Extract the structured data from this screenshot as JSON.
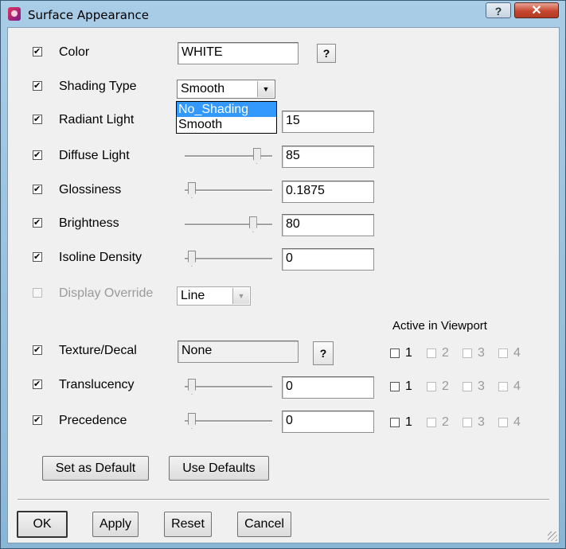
{
  "window": {
    "title": "Surface Appearance",
    "help_label": "?",
    "close_label": "✕"
  },
  "rows": [
    {
      "label": "Color",
      "value": "WHITE",
      "help": "?"
    },
    {
      "label": "Shading Type",
      "select": "Smooth",
      "options": [
        "No_Shading",
        "Smooth"
      ],
      "highlighted": "No_Shading"
    },
    {
      "label": "Radiant Light",
      "value": "15"
    },
    {
      "label": "Diffuse Light",
      "value": "85"
    },
    {
      "label": "Glossiness",
      "value": "0.1875"
    },
    {
      "label": "Brightness",
      "value": "80"
    },
    {
      "label": "Isoline Density",
      "value": "0"
    },
    {
      "label": "Display Override",
      "select": "Line"
    },
    {
      "label": "Texture/Decal",
      "value": "None",
      "help": "?"
    },
    {
      "label": "Translucency",
      "value": "0"
    },
    {
      "label": "Precedence",
      "value": "0"
    }
  ],
  "slider_levels": {
    "diffuse": 0.85,
    "glossiness": 0.0,
    "brightness": 0.8,
    "isoline": 0.0,
    "translucency": 0.0,
    "precedence": 0.0
  },
  "viewport": {
    "header": "Active in Viewport",
    "numbers": [
      "1",
      "2",
      "3",
      "4"
    ]
  },
  "buttons": {
    "set_default": "Set as Default",
    "use_defaults": "Use Defaults",
    "ok": "OK",
    "apply": "Apply",
    "reset": "Reset",
    "cancel": "Cancel"
  }
}
